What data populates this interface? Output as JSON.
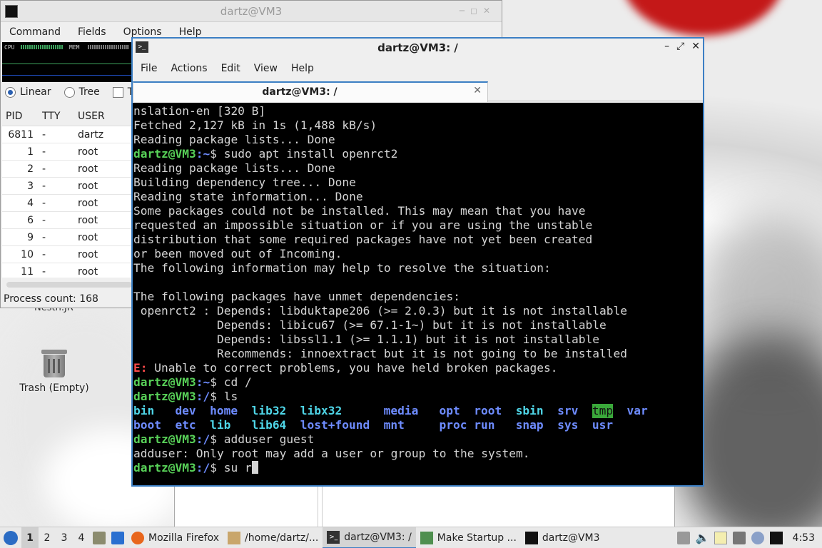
{
  "desktop": {
    "trash_label": "Trash (Empty)",
    "partial_label": "Nestn.JR"
  },
  "taskmanager": {
    "title": "dartz@VM3",
    "menu": [
      "Command",
      "Fields",
      "Options",
      "Help"
    ],
    "graph_labels": {
      "cpu": "CPU",
      "mem": "MEM"
    },
    "view_linear": "Linear",
    "view_tree": "Tree",
    "view_threads": "Th",
    "columns": {
      "pid": "PID",
      "tty": "TTY",
      "user": "USER"
    },
    "rows": [
      {
        "pid": "6811",
        "tty": "-",
        "user": "dartz"
      },
      {
        "pid": "1",
        "tty": "-",
        "user": "root"
      },
      {
        "pid": "2",
        "tty": "-",
        "user": "root"
      },
      {
        "pid": "3",
        "tty": "-",
        "user": "root"
      },
      {
        "pid": "4",
        "tty": "-",
        "user": "root"
      },
      {
        "pid": "6",
        "tty": "-",
        "user": "root"
      },
      {
        "pid": "9",
        "tty": "-",
        "user": "root"
      },
      {
        "pid": "10",
        "tty": "-",
        "user": "root"
      },
      {
        "pid": "11",
        "tty": "-",
        "user": "root"
      }
    ],
    "status": "Process count: 168"
  },
  "terminal": {
    "title": "dartz@VM3: /",
    "menu": [
      "File",
      "Actions",
      "Edit",
      "View",
      "Help"
    ],
    "tab_label": "dartz@VM3: /",
    "prompt_user": "dartz@VM3",
    "lines": [
      {
        "t": "nslation-en [320 B]"
      },
      {
        "t": "Fetched 2,127 kB in 1s (1,488 kB/s)"
      },
      {
        "t": "Reading package lists... Done"
      },
      {
        "prompt": true,
        "dir": "~",
        "cmd": " sudo apt install openrct2"
      },
      {
        "t": "Reading package lists... Done"
      },
      {
        "t": "Building dependency tree... Done"
      },
      {
        "t": "Reading state information... Done"
      },
      {
        "t": "Some packages could not be installed. This may mean that you have"
      },
      {
        "t": "requested an impossible situation or if you are using the unstable"
      },
      {
        "t": "distribution that some required packages have not yet been created"
      },
      {
        "t": "or been moved out of Incoming."
      },
      {
        "t": "The following information may help to resolve the situation:"
      },
      {
        "t": ""
      },
      {
        "t": "The following packages have unmet dependencies:"
      },
      {
        "t": " openrct2 : Depends: libduktape206 (>= 2.0.3) but it is not installable"
      },
      {
        "t": "            Depends: libicu67 (>= 67.1-1~) but it is not installable"
      },
      {
        "t": "            Depends: libssl1.1 (>= 1.1.1) but it is not installable"
      },
      {
        "t": "            Recommends: innoextract but it is not going to be installed"
      },
      {
        "err": "E:",
        "t": " Unable to correct problems, you have held broken packages."
      },
      {
        "prompt": true,
        "dir": "~",
        "cmd": " cd /"
      },
      {
        "prompt": true,
        "dir": "/",
        "cmd": " ls"
      },
      {
        "ls": 1
      },
      {
        "ls": 2
      },
      {
        "prompt": true,
        "dir": "/",
        "cmd": " adduser guest"
      },
      {
        "t": "adduser: Only root may add a user or group to the system."
      },
      {
        "prompt": true,
        "dir": "/",
        "cmd": " su r",
        "cursor": true
      }
    ],
    "ls_row1": [
      {
        "name": "bin",
        "kind": "ln"
      },
      {
        "name": "dev",
        "kind": "d"
      },
      {
        "name": "home",
        "kind": "d"
      },
      {
        "name": "lib32",
        "kind": "ln"
      },
      {
        "name": "libx32",
        "kind": "ln"
      },
      {
        "name": "media",
        "kind": "d"
      },
      {
        "name": "opt",
        "kind": "d"
      },
      {
        "name": "root",
        "kind": "d"
      },
      {
        "name": "sbin",
        "kind": "ln"
      },
      {
        "name": "srv",
        "kind": "d"
      },
      {
        "name": "tmp",
        "kind": "hi"
      },
      {
        "name": "var",
        "kind": "d"
      }
    ],
    "ls_row2": [
      {
        "name": "boot",
        "kind": "d"
      },
      {
        "name": "etc",
        "kind": "d"
      },
      {
        "name": "lib",
        "kind": "ln"
      },
      {
        "name": "lib64",
        "kind": "ln"
      },
      {
        "name": "lost+found",
        "kind": "d"
      },
      {
        "name": "mnt",
        "kind": "d"
      },
      {
        "name": "proc",
        "kind": "d"
      },
      {
        "name": "run",
        "kind": "d"
      },
      {
        "name": "snap",
        "kind": "d"
      },
      {
        "name": "sys",
        "kind": "d"
      },
      {
        "name": "usr",
        "kind": "d"
      }
    ]
  },
  "taskbar": {
    "workspaces": [
      "1",
      "2",
      "3",
      "4"
    ],
    "tasks": [
      {
        "label": "Mozilla Firefox",
        "icon": "firefox-icon",
        "color": "#e8661c"
      },
      {
        "label": "/home/dartz/...",
        "icon": "folder-icon",
        "color": "#c9a66b"
      },
      {
        "label": "dartz@VM3: /",
        "icon": "terminal-icon",
        "color": "#333333",
        "active": true
      },
      {
        "label": "Make Startup ...",
        "icon": "installer-icon",
        "color": "#4f8f4f"
      },
      {
        "label": "dartz@VM3",
        "icon": "taskmanager-icon",
        "color": "#111111"
      }
    ],
    "clock": "4:53"
  },
  "colors": {
    "accent": "#3c7fc4",
    "prompt": "#58d158",
    "dir": "#6e8cff",
    "error": "#ff4b4b"
  }
}
